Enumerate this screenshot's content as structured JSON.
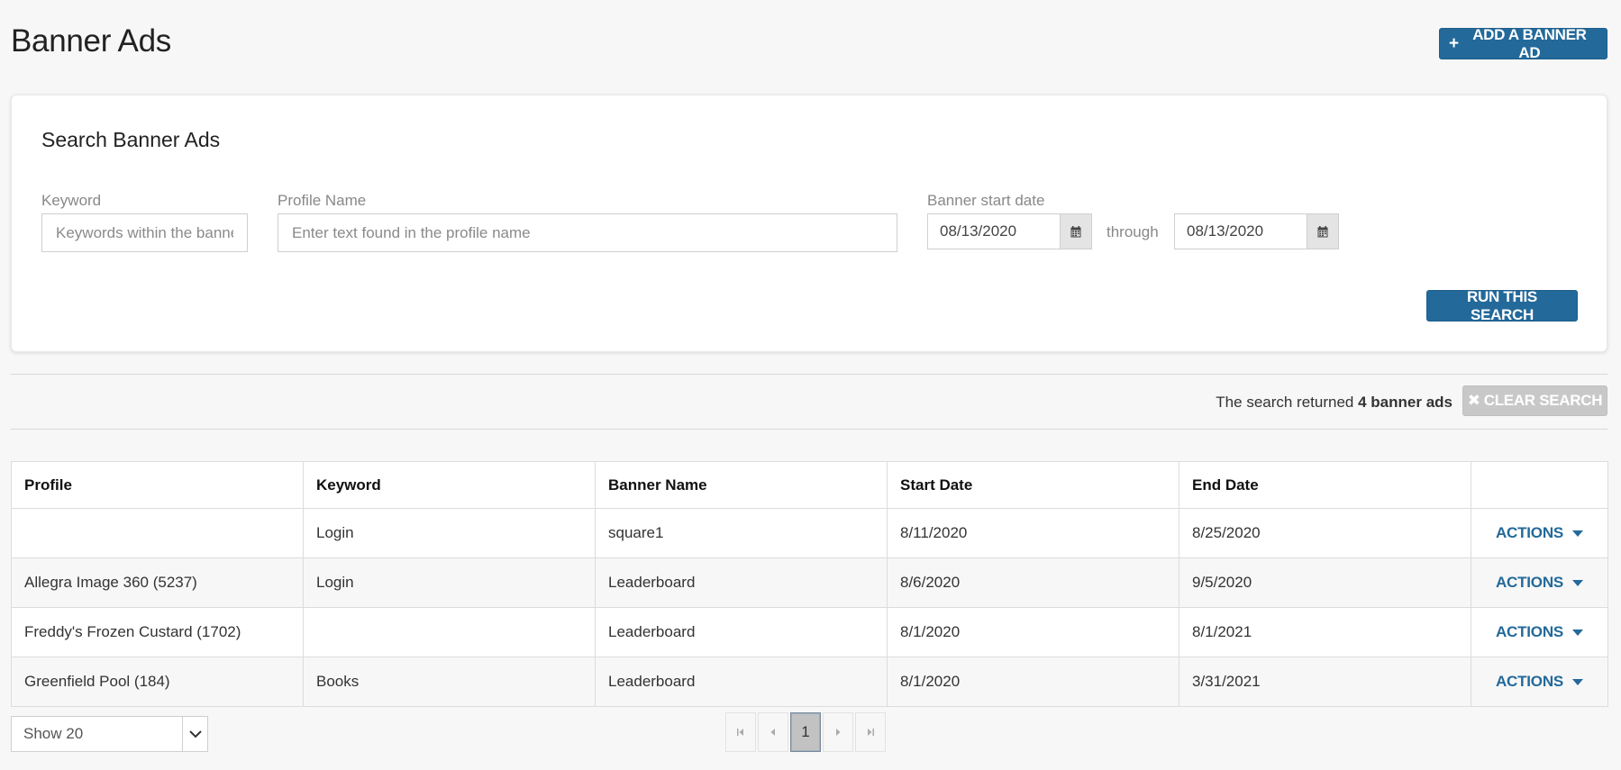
{
  "header": {
    "title": "Banner Ads",
    "add_button_label": "ADD A BANNER AD",
    "add_button_icon": "plus-icon"
  },
  "search": {
    "title": "Search Banner Ads",
    "keyword_label": "Keyword",
    "keyword_placeholder": "Keywords within the banner",
    "keyword_value": "",
    "profile_label": "Profile Name",
    "profile_placeholder": "Enter text found in the profile name",
    "profile_value": "",
    "start_date_label": "Banner start date",
    "start_date_from": "08/13/2020",
    "through_label": "through",
    "start_date_to": "08/13/2020",
    "calendar_icon": "calendar-icon",
    "run_button_label": "RUN THIS SEARCH"
  },
  "results": {
    "prefix": "The search returned",
    "count_text": "4 banner ads",
    "clear_button_label": "CLEAR SEARCH",
    "clear_icon": "close-icon"
  },
  "table": {
    "columns": [
      "Profile",
      "Keyword",
      "Banner Name",
      "Start Date",
      "End Date",
      ""
    ],
    "rows": [
      {
        "profile": "",
        "keyword": "Login",
        "banner_name": "square1",
        "start_date": "8/11/2020",
        "end_date": "8/25/2020",
        "action": "ACTIONS"
      },
      {
        "profile": "Allegra Image 360 (5237)",
        "keyword": "Login",
        "banner_name": "Leaderboard",
        "start_date": "8/6/2020",
        "end_date": "9/5/2020",
        "action": "ACTIONS"
      },
      {
        "profile": "Freddy's Frozen Custard (1702)",
        "keyword": "",
        "banner_name": "Leaderboard",
        "start_date": "8/1/2020",
        "end_date": "8/1/2021",
        "action": "ACTIONS"
      },
      {
        "profile": "Greenfield Pool (184)",
        "keyword": "Books",
        "banner_name": "Leaderboard",
        "start_date": "8/1/2020",
        "end_date": "3/31/2021",
        "action": "ACTIONS"
      }
    ]
  },
  "footer": {
    "page_size_selected": "Show 20",
    "current_page": "1"
  },
  "colors": {
    "primary": "#23699a",
    "disabled": "#c8c8c8",
    "background": "#f7f7f7"
  }
}
